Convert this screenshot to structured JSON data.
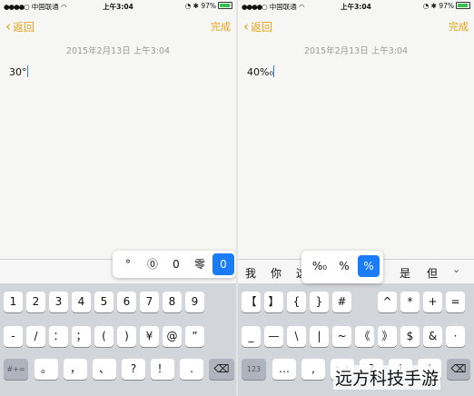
{
  "colors": {
    "accent": "#e4a318",
    "selected": "#1a7cf7",
    "battery": "#33c24d"
  },
  "status": {
    "signal_dots": "●●●●○",
    "carrier": "中国联通",
    "wifi_icon": "wifi-icon",
    "time": "上午3:04",
    "battery_percent": "97%",
    "battery_level": 0.97
  },
  "nav": {
    "back_label": "返回",
    "done_label": "完成"
  },
  "left": {
    "date": "2015年2月13日  上午3:04",
    "note_text": "30°",
    "popup": [
      "°",
      "⓪",
      "0",
      "零",
      "0"
    ],
    "popup_selected": 4,
    "row1": [
      "1",
      "2",
      "3",
      "4",
      "5",
      "6",
      "7",
      "8",
      "9"
    ],
    "row2": [
      "-",
      "/",
      "：",
      "；",
      "(",
      ")",
      "¥",
      "@",
      "”"
    ],
    "row3": [
      "#+=",
      "。",
      "，",
      "、",
      "?",
      "！",
      "."
    ],
    "delete_icon": "backspace-icon"
  },
  "right": {
    "date": "2015年2月13日  上午3:04",
    "note_text": "40%₀",
    "candidates": [
      "我",
      "你",
      "这",
      "是",
      "但"
    ],
    "popup": [
      "%₀",
      "%",
      "%"
    ],
    "popup_selected": 2,
    "row1": [
      "【",
      "】",
      "{",
      "}",
      "#",
      "^",
      "*",
      "+",
      "="
    ],
    "row2": [
      "_",
      "—",
      "\\",
      "|",
      "~",
      "《",
      "》",
      "$",
      "&",
      "·"
    ],
    "row3": [
      "123",
      "…",
      ",",
      "^_^",
      "?",
      "!",
      "'"
    ],
    "expand_icon": "chevron-down-icon",
    "delete_icon": "backspace-icon"
  },
  "watermark": "远方科技手游"
}
